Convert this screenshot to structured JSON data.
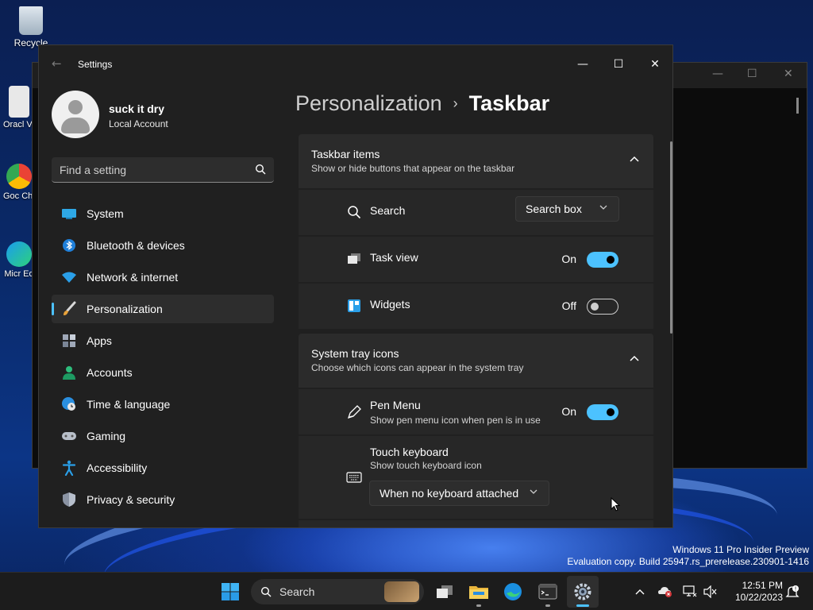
{
  "desktop": {
    "icons": [
      {
        "label": "Recycle"
      },
      {
        "label": "Oracl Virtu"
      },
      {
        "label": "Goc Chro"
      },
      {
        "label": "Micr Ed"
      }
    ],
    "watermark": {
      "line1": "Windows 11 Pro Insider Preview",
      "line2": "Evaluation copy. Build 25947.rs_prerelease.230901-1416"
    }
  },
  "background_window": {
    "minimize": "—",
    "maximize": "☐",
    "close": "✕"
  },
  "settings": {
    "title": "Settings",
    "back": "←",
    "minimize": "—",
    "maximize": "☐",
    "close": "✕",
    "user": {
      "name": "suck it dry",
      "account_type": "Local Account"
    },
    "search": {
      "placeholder": "Find a setting"
    },
    "nav": [
      {
        "label": "System",
        "icon": "system-icon"
      },
      {
        "label": "Bluetooth & devices",
        "icon": "bluetooth-icon"
      },
      {
        "label": "Network & internet",
        "icon": "wifi-icon"
      },
      {
        "label": "Personalization",
        "icon": "brush-icon",
        "active": true
      },
      {
        "label": "Apps",
        "icon": "apps-icon"
      },
      {
        "label": "Accounts",
        "icon": "accounts-icon"
      },
      {
        "label": "Time & language",
        "icon": "globe-clock-icon"
      },
      {
        "label": "Gaming",
        "icon": "gamepad-icon"
      },
      {
        "label": "Accessibility",
        "icon": "accessibility-icon"
      },
      {
        "label": "Privacy & security",
        "icon": "shield-icon"
      }
    ],
    "breadcrumb": {
      "parent": "Personalization",
      "separator": "›",
      "current": "Taskbar"
    },
    "sections": {
      "taskbar_items": {
        "title": "Taskbar items",
        "subtitle": "Show or hide buttons that appear on the taskbar",
        "search": {
          "label": "Search",
          "value": "Search box"
        },
        "task_view": {
          "label": "Task view",
          "state": "On"
        },
        "widgets": {
          "label": "Widgets",
          "state": "Off"
        }
      },
      "system_tray": {
        "title": "System tray icons",
        "subtitle": "Choose which icons can appear in the system tray",
        "pen_menu": {
          "label": "Pen Menu",
          "sub": "Show pen menu icon when pen is in use",
          "state": "On"
        },
        "touch_keyboard": {
          "label": "Touch keyboard",
          "sub": "Show touch keyboard icon",
          "value": "When no keyboard attached"
        }
      }
    }
  },
  "taskbar": {
    "search_label": "Search",
    "clock": {
      "time": "12:51 PM",
      "date": "10/22/2023"
    }
  },
  "colors": {
    "accent": "#4cc2ff",
    "window_bg": "#202020",
    "card_bg": "#2b2b2b",
    "row_bg": "#272727"
  }
}
